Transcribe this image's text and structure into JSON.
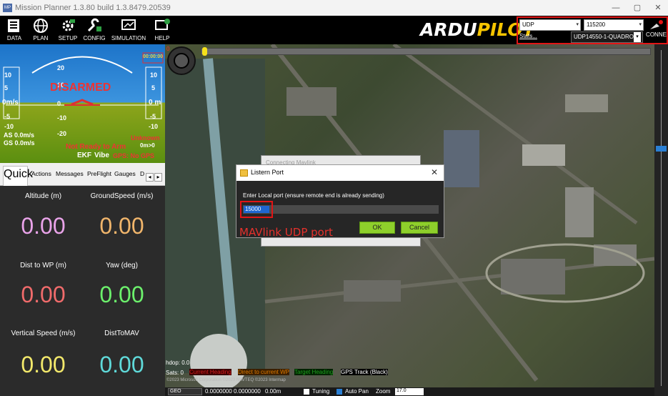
{
  "window": {
    "title": "Mission Planner 1.3.80 build 1.3.8479.20539",
    "minimize": "—",
    "restore": "▢",
    "close": "✕"
  },
  "toolbar": {
    "buttons": [
      {
        "label": "DATA",
        "icon": "monitor-icon"
      },
      {
        "label": "PLAN",
        "icon": "globe-icon"
      },
      {
        "label": "SETUP",
        "icon": "gear-icon"
      },
      {
        "label": "CONFIG",
        "icon": "wrench-icon"
      },
      {
        "label": "SIMULATION",
        "icon": "simulation-icon"
      },
      {
        "label": "HELP",
        "icon": "help-icon"
      }
    ],
    "logo_white": "ARDU",
    "logo_yellow": "PILOT"
  },
  "connection": {
    "protocol": "UDP",
    "baud": "115200",
    "stats": "Stats...",
    "vehicle": "UDP14550-1-QUADRO",
    "connect_label": "CONNE"
  },
  "hud": {
    "status": "DISARMED",
    "left_labels": [
      "10",
      "5",
      "0m/s",
      "-5",
      "-10"
    ],
    "right_labels": [
      "10",
      "5",
      "0 m",
      "-5",
      "-10"
    ],
    "pitch_labels": [
      "20",
      "10",
      "0",
      "-10",
      "-20"
    ],
    "as": "AS 0.0m/s",
    "gs": "GS 0.0m/s",
    "not_ready": "Not Ready to Arm",
    "unknown": "Unknown",
    "dist": "0m>0",
    "ekf": "EKF",
    "vibe": "Vibe",
    "gps": "GPS: No GPS",
    "heading": "00:00:00"
  },
  "tabs": {
    "items": [
      "Quick",
      "Actions",
      "Messages",
      "PreFlight",
      "Gauges",
      "D"
    ],
    "scroll_left": "◂",
    "scroll_right": "▸"
  },
  "quick": {
    "cells": [
      {
        "label": "Altitude (m)",
        "value": "0.00",
        "color": "#e9a3e9"
      },
      {
        "label": "GroundSpeed (m/s)",
        "value": "0.00",
        "color": "#f0b56b"
      },
      {
        "label": "Dist to WP (m)",
        "value": "0.00",
        "color": "#f06b6b"
      },
      {
        "label": "Yaw (deg)",
        "value": "0.00",
        "color": "#6cf06c"
      },
      {
        "label": "Vertical Speed (m/s)",
        "value": "0.00",
        "color": "#f2e86b"
      },
      {
        "label": "DistToMAV",
        "value": "0.00",
        "color": "#5fd9d9"
      }
    ]
  },
  "map": {
    "hdop": "hdop: 0.0",
    "sats": "Sats: 0",
    "legend": [
      {
        "label": "Current Heading",
        "color": "#d62020"
      },
      {
        "label": "Direct to current WP",
        "color": "#e07a00"
      },
      {
        "label": "Target Heading",
        "color": "#1f9e1f"
      },
      {
        "label": "GPS Track (Black)",
        "color": "#000000"
      }
    ],
    "copyright": "©2023 Microsoft Corporation ©2023 NAVTEQ ©2023 Intermap",
    "progress_zero": "0"
  },
  "status": {
    "coord_mode": "GEO",
    "coords": "0.0000000 0.0000000",
    "alt": "0.00m",
    "tuning": "Tuning",
    "autopan": "Auto Pan",
    "zoom_label": "Zoom",
    "zoom_value": "17.0"
  },
  "dialog": {
    "back_title": "Connecting Mavlink",
    "title": "Listern Port",
    "close": "✕",
    "message": "Enter Local port (ensure remote end is already sending)",
    "port_value": "15000",
    "ok": "OK",
    "cancel": "Cancel"
  },
  "annotation": "MAVlink UDP port"
}
